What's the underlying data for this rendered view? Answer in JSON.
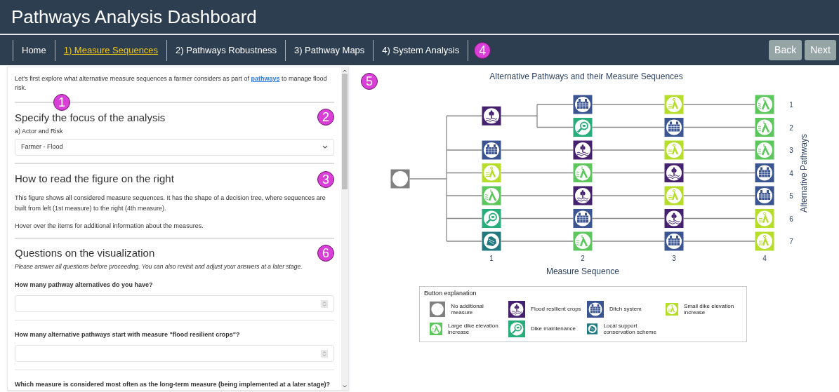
{
  "header": {
    "title": "Pathways Analysis Dashboard"
  },
  "nav": {
    "tabs": [
      {
        "label": "Home",
        "selected": false
      },
      {
        "label": "1) Measure Sequences",
        "selected": true
      },
      {
        "label": "2) Pathways Robustness",
        "selected": false
      },
      {
        "label": "3) Pathway Maps",
        "selected": false
      },
      {
        "label": "4) System Analysis",
        "selected": false
      }
    ],
    "buttons": [
      "Back",
      "Next"
    ]
  },
  "callouts": [
    "1",
    "2",
    "3",
    "4",
    "5",
    "6"
  ],
  "left_panel": {
    "intro": {
      "before": "Let's first explore what alternative measure sequences a farmer considers as part of",
      "link": "pathways",
      "after": "to manage flood risk."
    },
    "focus": {
      "heading": "Specify the focus of the analysis",
      "select_label": "a) Actor and Risk",
      "select_value": "Farmer - Flood"
    },
    "read": {
      "heading": "How to read the figure on the right",
      "paragraphs": [
        "This figure shows all considered measure sequences. It has the shape of a decision tree, where sequences are built from left (1st measure) to the right (4th measure).",
        "Hover over the items for additional information about the measures."
      ]
    },
    "questions": {
      "heading": "Questions on the visualization",
      "note": "Please answer all questions before proceeding. You can also revisit and adjust your answers at a later stage.",
      "items": [
        {
          "label": "How many pathway alternatives do you have?",
          "field": {
            "kind": "number"
          }
        },
        {
          "label": "How many alternative pathways start with measure \"flood resilient crops\"?",
          "field": {
            "kind": "number"
          }
        },
        {
          "label": "Which measure is considered most often as the long-term measure (being implemented at a later stage)?"
        }
      ]
    }
  },
  "diagram": {
    "title": "Alternative Pathways and their Measure Sequences",
    "xlabel": "Measure Sequence",
    "ylabel": "Alternative Pathways",
    "xticks": [
      "1",
      "2",
      "3",
      "4"
    ],
    "start": {
      "kind": "none"
    },
    "pathways": [
      {
        "label": "1",
        "steps": [
          {
            "kind": "crops"
          },
          {
            "kind": "ditch"
          },
          {
            "kind": "small"
          },
          {
            "kind": "large"
          }
        ]
      },
      {
        "label": "2",
        "steps": [
          {
            "kind": "crops"
          },
          {
            "kind": "maintenance"
          },
          {
            "kind": "ditch"
          },
          {
            "kind": "large"
          }
        ]
      },
      {
        "label": "3",
        "steps": [
          {
            "kind": "ditch"
          },
          {
            "kind": "crops"
          },
          {
            "kind": "small"
          },
          {
            "kind": "large"
          }
        ]
      },
      {
        "label": "4",
        "steps": [
          {
            "kind": "small"
          },
          {
            "kind": "large"
          },
          {
            "kind": "crops"
          },
          {
            "kind": "ditch"
          }
        ]
      },
      {
        "label": "5",
        "steps": [
          {
            "kind": "large"
          },
          {
            "kind": "crops"
          },
          {
            "kind": "small"
          },
          {
            "kind": "ditch"
          }
        ]
      },
      {
        "label": "6",
        "steps": [
          {
            "kind": "maintenance"
          },
          {
            "kind": "ditch"
          },
          {
            "kind": "crops"
          },
          {
            "kind": "small"
          }
        ]
      },
      {
        "label": "7",
        "steps": [
          {
            "kind": "local"
          },
          {
            "kind": "large"
          },
          {
            "kind": "ditch"
          },
          {
            "kind": "small"
          }
        ]
      }
    ]
  },
  "legend": {
    "title": "Button explanation",
    "items": [
      {
        "kind": "none",
        "label": "No additional measure",
        "color": "#808080"
      },
      {
        "kind": "crops",
        "label": "Flood resilient crops",
        "color": "#44206f"
      },
      {
        "kind": "ditch",
        "label": "Ditch system",
        "color": "#3b5592"
      },
      {
        "kind": "small",
        "label": "Small dike elevation increase",
        "color": "#b5dd2a"
      },
      {
        "kind": "large",
        "label": "Large dike elevation increase",
        "color": "#5cc75c"
      },
      {
        "kind": "maintenance",
        "label": "Dike maintenance",
        "color": "#27ae7a"
      },
      {
        "kind": "local",
        "label": "Local support conservation scheme",
        "color": "#22787f"
      }
    ]
  }
}
